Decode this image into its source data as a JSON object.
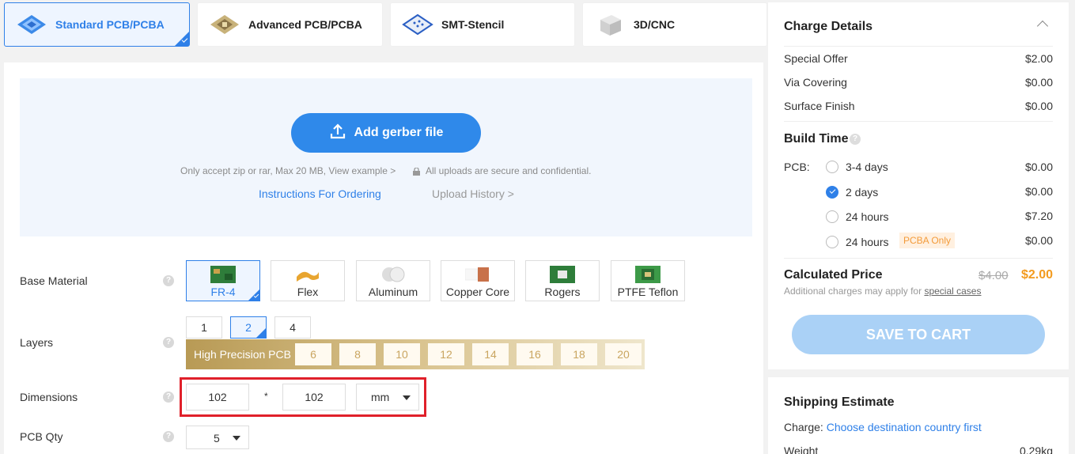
{
  "tabs": [
    {
      "label": "Standard PCB/PCBA",
      "active": true,
      "icon": "pcb-stack-icon"
    },
    {
      "label": "Advanced PCB/PCBA",
      "active": false,
      "icon": "chip-icon"
    },
    {
      "label": "SMT-Stencil",
      "active": false,
      "icon": "stencil-icon"
    },
    {
      "label": "3D/CNC",
      "active": false,
      "icon": "cube-icon"
    }
  ],
  "upload": {
    "button_label": "Add gerber file",
    "note": "Only accept zip or rar, Max 20 MB, View example >",
    "secure_note": "All uploads are secure and confidential.",
    "instructions_link": "Instructions For Ordering",
    "history_link": "Upload History >"
  },
  "base_material": {
    "label": "Base Material",
    "options": [
      "FR-4",
      "Flex",
      "Aluminum",
      "Copper Core",
      "Rogers",
      "PTFE Teflon"
    ],
    "selected": "FR-4"
  },
  "layers": {
    "label": "Layers",
    "options": [
      "1",
      "2",
      "4"
    ],
    "selected": "2",
    "high_precision_label": "High Precision PCB",
    "high_precision_options": [
      "6",
      "8",
      "10",
      "12",
      "14",
      "16",
      "18",
      "20"
    ]
  },
  "dimensions": {
    "label": "Dimensions",
    "width": "102",
    "separator": "*",
    "height": "102",
    "unit": "mm"
  },
  "pcb_qty": {
    "label": "PCB Qty",
    "value": "5"
  },
  "charge_details": {
    "title": "Charge Details",
    "rows": [
      {
        "label": "Special Offer",
        "value": "$2.00"
      },
      {
        "label": "Via Covering",
        "value": "$0.00"
      },
      {
        "label": "Surface Finish",
        "value": "$0.00"
      }
    ],
    "build_time_title": "Build Time",
    "pcb_label": "PCB:",
    "build_options": [
      {
        "label": "3-4 days",
        "value": "$0.00",
        "selected": false
      },
      {
        "label": "2 days",
        "value": "$0.00",
        "selected": true
      },
      {
        "label": "24 hours",
        "value": "$7.20",
        "selected": false
      },
      {
        "label": "24 hours",
        "value": "$0.00",
        "selected": false
      }
    ],
    "pcba_badge": "PCBA Only",
    "calculated_label": "Calculated Price",
    "old_price": "$4.00",
    "new_price": "$2.00",
    "additional_note": "Additional charges may apply for",
    "special_cases_link": "special cases",
    "save_button": "SAVE TO CART"
  },
  "shipping": {
    "title": "Shipping Estimate",
    "charge_label": "Charge:",
    "charge_link": "Choose destination country first",
    "weight_label": "Weight",
    "weight_value": "0.29kg"
  },
  "colors": {
    "accent": "#2f80e8",
    "price": "#f39b1e",
    "highlight_box": "#e0202a"
  }
}
